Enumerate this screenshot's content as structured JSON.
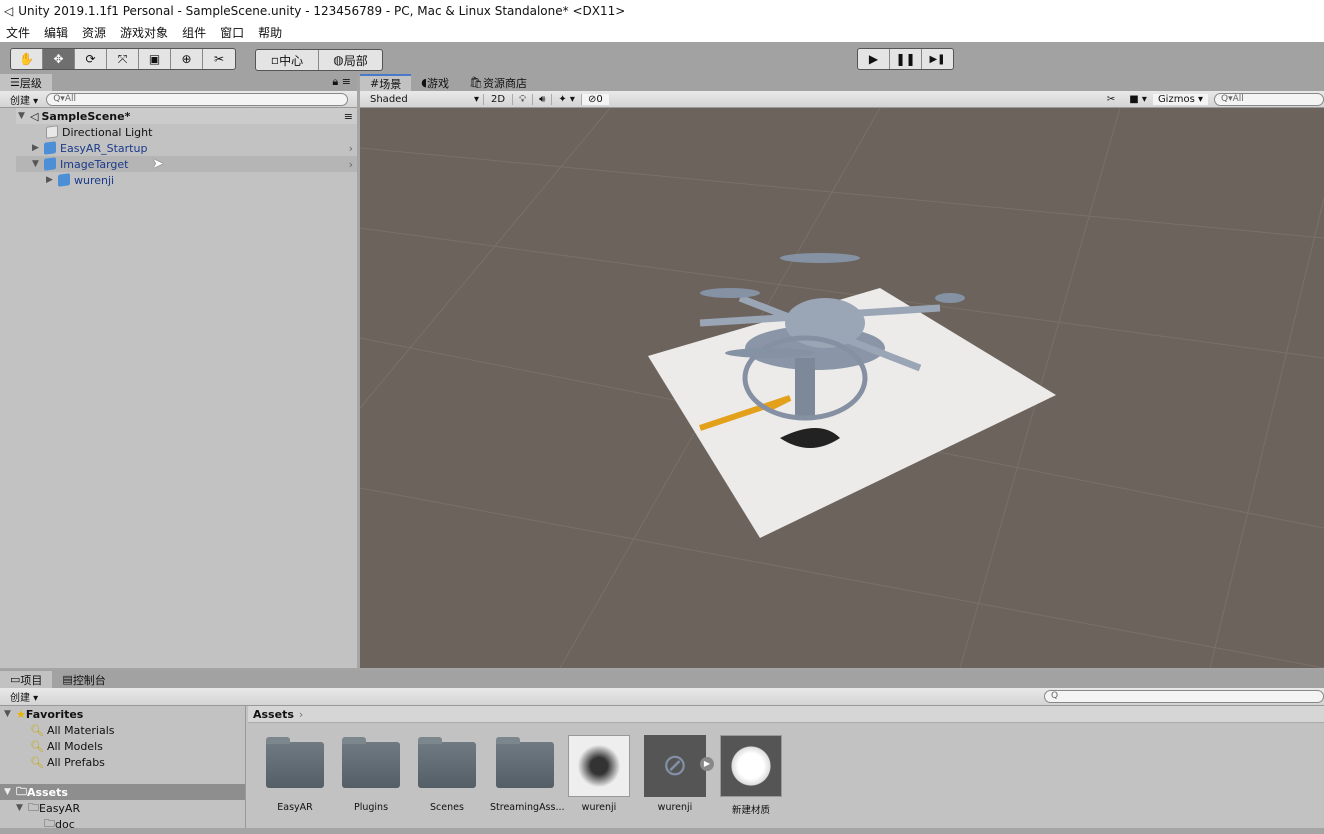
{
  "title": "Unity 2019.1.1f1 Personal - SampleScene.unity - 123456789 - PC, Mac & Linux Standalone* <DX11>",
  "menu": [
    "文件",
    "编辑",
    "资源",
    "游戏对象",
    "组件",
    "窗口",
    "帮助"
  ],
  "toolbar": {
    "tools": [
      "hand",
      "move",
      "rotate",
      "scale",
      "rect",
      "transform",
      "custom"
    ],
    "pivot": "中心",
    "space": "局部",
    "play": "▶",
    "pause": "❚❚",
    "step": "▶❚"
  },
  "hierarchy": {
    "tab": "层级",
    "create": "创建",
    "search": "All",
    "scene": "SampleScene*",
    "items": [
      {
        "name": "Directional Light",
        "depth": 1
      },
      {
        "name": "EasyAR_Startup",
        "depth": 1
      },
      {
        "name": "ImageTarget",
        "depth": 1
      },
      {
        "name": "wurenji",
        "depth": 2
      }
    ]
  },
  "scene_tabs": {
    "scene": "场景",
    "game": "游戏",
    "store": "资源商店"
  },
  "scene_bar": {
    "shading": "Shaded",
    "mode2d": "2D",
    "hidden": "0",
    "gizmos": "Gizmos",
    "search": "All"
  },
  "project": {
    "tab": "项目",
    "console": "控制台",
    "create": "创建",
    "favorites": "Favorites",
    "fav_items": [
      "All Materials",
      "All Models",
      "All Prefabs"
    ],
    "assets": "Assets",
    "tree": [
      "EasyAR",
      "doc"
    ],
    "breadcrumb": "Assets",
    "files": [
      "EasyAR",
      "Plugins",
      "Scenes",
      "StreamingAss...",
      "wurenji",
      "wurenji",
      "新建材质"
    ]
  }
}
